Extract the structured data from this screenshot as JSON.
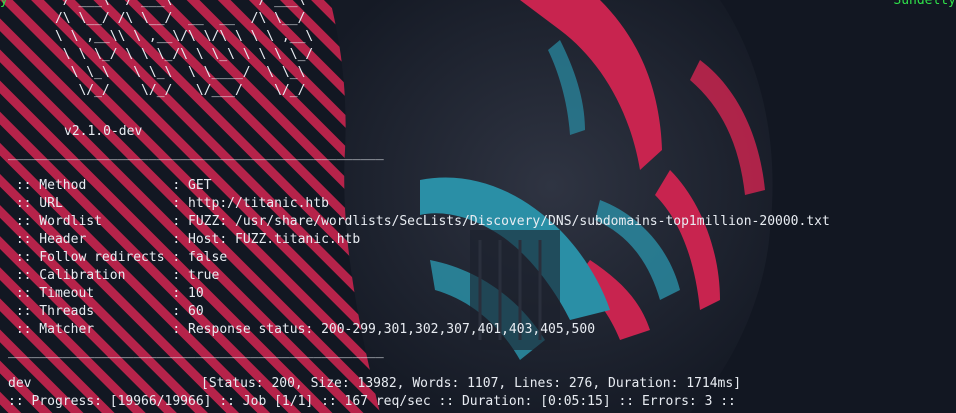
{
  "terminal": {
    "top_left_fragment": "y",
    "top_right_fragment": "Sundelty",
    "banner_ascii": "       /'___\\  /'___\\           /'___\\\n      /\\ \\__/ /\\ \\__/  __  __  /\\ \\__/\n      \\ \\ ,__\\\\ \\ ,__\\/\\ \\/\\ \\ \\ \\ ,__\\\n       \\ \\ \\_/ \\ \\ \\_/\\ \\ \\_\\ \\ \\ \\ \\_/\n        \\ \\_\\   \\ \\_\\  \\ \\____/  \\ \\_\\\n         \\/_/    \\/_/   \\/___/    \\/_/",
    "version": "v2.1.0-dev",
    "separator": "________________________________________________",
    "config": [
      {
        "key": " :: Method           ",
        "value": ": GET"
      },
      {
        "key": " :: URL              ",
        "value": ": http://titanic.htb"
      },
      {
        "key": " :: Wordlist         ",
        "value": ": FUZZ: /usr/share/wordlists/SecLists/Discovery/DNS/subdomains-top1million-20000.txt"
      },
      {
        "key": " :: Header           ",
        "value": ": Host: FUZZ.titanic.htb"
      },
      {
        "key": " :: Follow redirects ",
        "value": ": false"
      },
      {
        "key": " :: Calibration      ",
        "value": ": true"
      },
      {
        "key": " :: Timeout          ",
        "value": ": 10"
      },
      {
        "key": " :: Threads          ",
        "value": ": 60"
      },
      {
        "key": " :: Matcher          ",
        "value": ": Response status: 200-299,301,302,307,401,403,405,500"
      }
    ],
    "result": {
      "word": "dev",
      "details": "[Status: 200, Size: 13982, Words: 1107, Lines: 276, Duration: 1714ms]"
    },
    "progress": ":: Progress: [19966/19966] :: Job [1/1] :: 167 req/sec :: Duration: [0:05:15] :: Errors: 3 ::"
  },
  "colors": {
    "background": "#121722",
    "text": "#e8ecf2",
    "accent_green": "#2fe04a",
    "wallpaper_red": "#c8244f",
    "wallpaper_teal": "#2a8fa6",
    "wallpaper_dark": "#262a36"
  }
}
